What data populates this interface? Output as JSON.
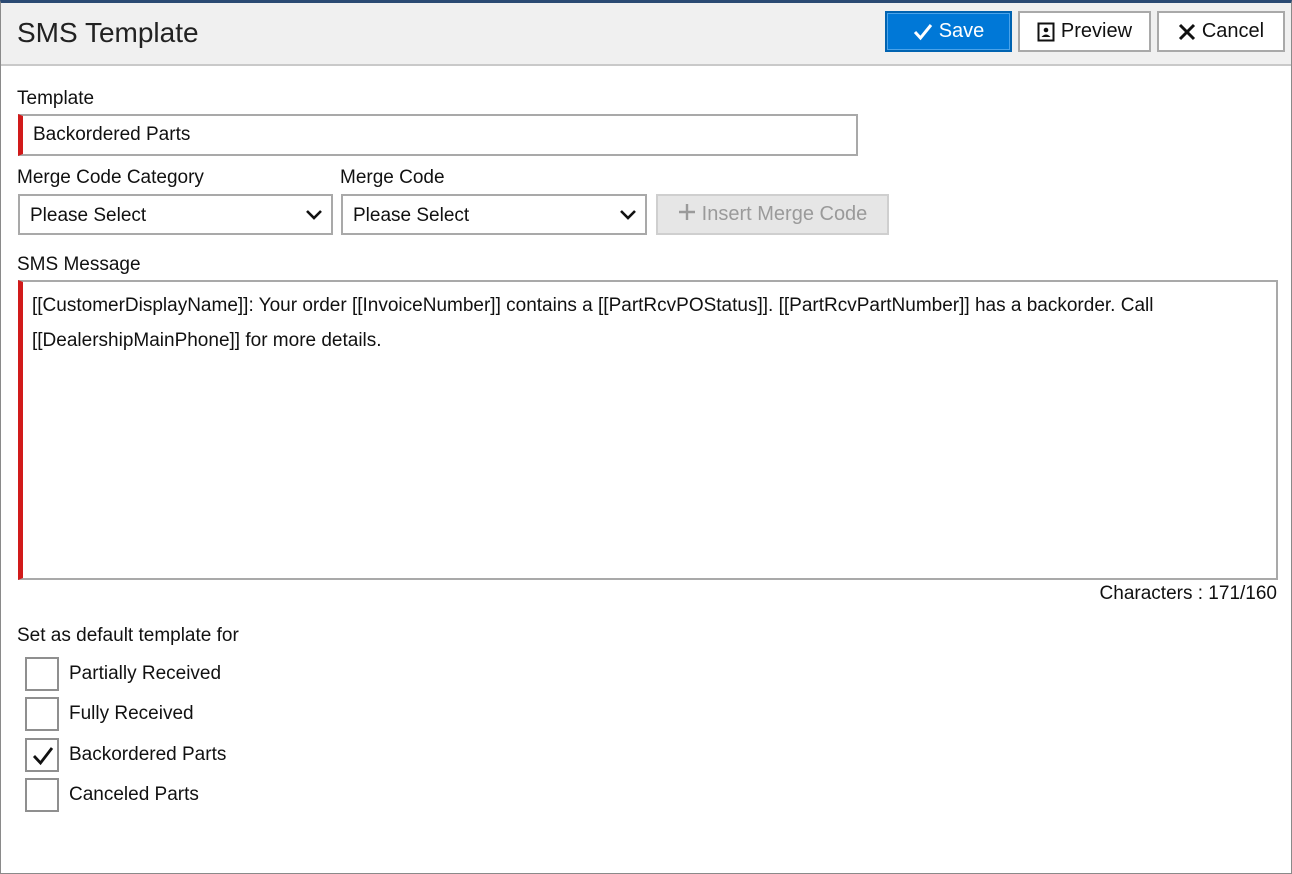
{
  "header": {
    "title": "SMS Template",
    "save_label": "Save",
    "preview_label": "Preview",
    "cancel_label": "Cancel"
  },
  "template_field": {
    "label": "Template",
    "value": "Backordered Parts"
  },
  "merge_code_category": {
    "label": "Merge Code Category",
    "selected": "Please Select"
  },
  "merge_code": {
    "label": "Merge Code",
    "selected": "Please Select"
  },
  "insert_button": {
    "label": "Insert Merge Code"
  },
  "sms_message": {
    "label": "SMS Message",
    "value": "[[CustomerDisplayName]]: Your order [[InvoiceNumber]] contains a [[PartRcvPOStatus]]. [[PartRcvPartNumber]] has a backorder. Call [[DealershipMainPhone]] for more details."
  },
  "character_count": {
    "text": "Characters : 171/160"
  },
  "defaults": {
    "heading": "Set as default template for",
    "options": [
      {
        "label": "Partially Received",
        "checked": false
      },
      {
        "label": "Fully Received",
        "checked": false
      },
      {
        "label": "Backordered Parts",
        "checked": true
      },
      {
        "label": "Canceled Parts",
        "checked": false
      }
    ]
  },
  "colors": {
    "primary": "#0078d7",
    "required": "#d11a1a"
  },
  "icons": {
    "save": "check-icon",
    "preview": "preview-document-icon",
    "cancel": "close-icon",
    "insert": "plus-icon",
    "dropdown": "chevron-down-icon"
  }
}
